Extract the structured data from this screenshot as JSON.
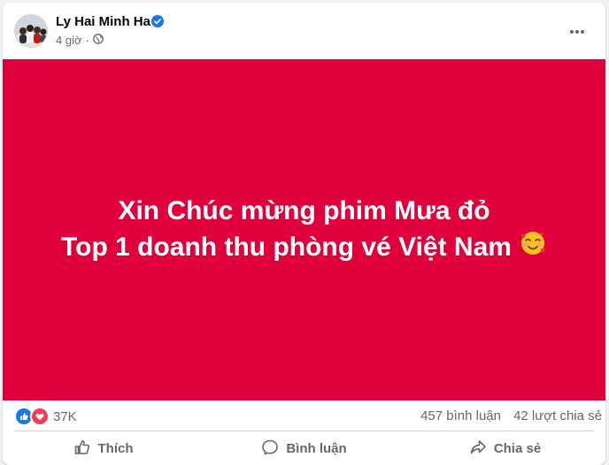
{
  "post": {
    "author": "Ly Hai Minh Ha",
    "time": "4 giờ",
    "privacy_icon": "globe-icon",
    "verified_icon": "verified-badge-icon",
    "more_icon": "more-horizontal-icon",
    "banner": {
      "line1": "Xin Chúc mừng phim Mưa đỏ",
      "line2": "Top 1 doanh thu phòng vé Việt Nam",
      "emoji": "🥰",
      "background_color": "#e0003b",
      "text_color": "#ffffff"
    },
    "stats": {
      "reaction_icons": [
        "like-icon",
        "love-icon"
      ],
      "reaction_count": "37K",
      "comments": "457 bình luận",
      "shares": "42 lượt chia sẻ"
    },
    "actions": [
      {
        "label": "Thích",
        "icon": "thumbs-up-icon"
      },
      {
        "label": "Bình luận",
        "icon": "comment-icon"
      },
      {
        "label": "Chia sẻ",
        "icon": "share-icon"
      }
    ]
  },
  "colors": {
    "verified": "#1877f2",
    "like": "#1877f2",
    "love": "#f33e58",
    "secondary_text": "#65676b"
  }
}
